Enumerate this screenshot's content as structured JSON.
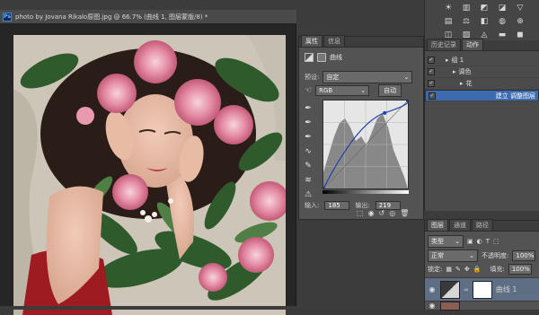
{
  "document": {
    "title": "photo by Jovana Rikalo原图.jpg @ 66.7% (曲线 1, 图层蒙版/8) *",
    "app_badge": "Ps"
  },
  "properties_panel": {
    "tabs": [
      "属性",
      "信息"
    ],
    "panel_name": "曲线",
    "preset_label": "预设:",
    "preset_value": "自定",
    "channel_value": "RGB",
    "auto_button": "自动",
    "input_label": "输入:",
    "input_value": "185",
    "output_label": "输出:",
    "output_value": "219"
  },
  "actions_panel": {
    "tabs": [
      "历史记录",
      "动作"
    ],
    "items": [
      {
        "label": "组 1",
        "checked": true,
        "selected": false,
        "indent": 0
      },
      {
        "label": "调色",
        "checked": true,
        "selected": false,
        "indent": 1
      },
      {
        "label": "花",
        "checked": true,
        "selected": false,
        "indent": 2
      },
      {
        "label": "建立 调整图层",
        "checked": true,
        "selected": true,
        "indent": 3
      }
    ]
  },
  "layers_panel": {
    "tabs": [
      "图层",
      "通道",
      "路径"
    ],
    "kind_value": "类型",
    "blend_mode": "正常",
    "opacity_label": "不透明度:",
    "opacity_value": "100%",
    "lock_label": "锁定:",
    "fill_label": "填充:",
    "fill_value": "100%",
    "layer_name": "曲线 1"
  },
  "curve": {
    "input": 185,
    "output": 219
  }
}
